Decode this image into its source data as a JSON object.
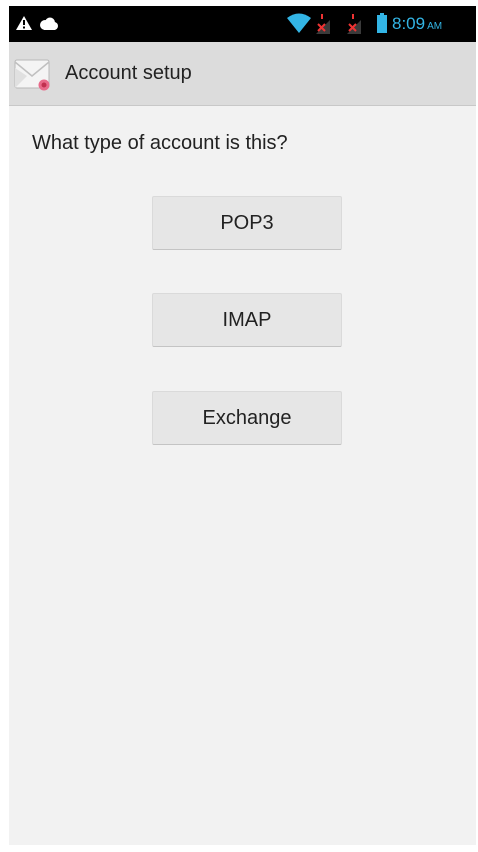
{
  "status_bar": {
    "time": "8:09",
    "ampm": "AM",
    "icons": [
      "warning-icon",
      "cloud-icon",
      "wifi-icon",
      "signal-no-data-icon",
      "signal-no-data-icon",
      "battery-icon"
    ],
    "accent_color": "#33b5e5"
  },
  "action_bar": {
    "icon": "email-envelope-icon",
    "title": "Account setup"
  },
  "main": {
    "question": "What type of account is this?",
    "buttons": {
      "pop3": "POP3",
      "imap": "IMAP",
      "exchange": "Exchange"
    }
  },
  "colors": {
    "background": "#f2f2f2",
    "action_bar": "#dcdcdc",
    "button": "#e6e6e6",
    "status_bar": "#000000"
  }
}
